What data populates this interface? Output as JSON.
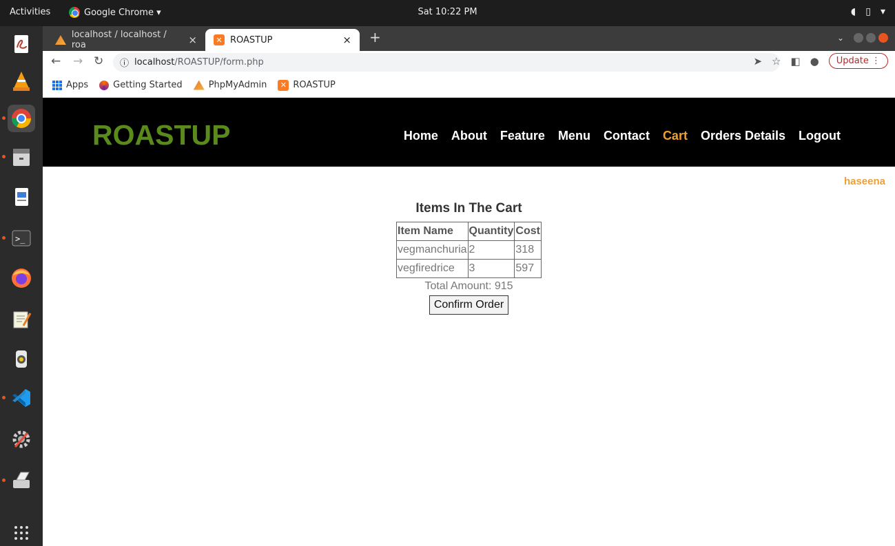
{
  "topbar": {
    "activities": "Activities",
    "app_name": "Google Chrome ▾",
    "clock": "Sat 10:22 PM"
  },
  "browser": {
    "tabs": [
      {
        "title": "localhost / localhost / roa",
        "active": false
      },
      {
        "title": "ROASTUP",
        "active": true
      }
    ],
    "url_host": "localhost",
    "url_path": "/ROASTUP/form.php",
    "update_label": "Update",
    "bookmarks": [
      "Apps",
      "Getting Started",
      "PhpMyAdmin",
      "ROASTUP"
    ]
  },
  "site": {
    "logo": "ROASTUP",
    "nav": [
      "Home",
      "About",
      "Feature",
      "Menu",
      "Contact",
      "Cart",
      "Orders Details",
      "Logout"
    ],
    "active_nav": "Cart",
    "username": "haseena"
  },
  "cart": {
    "heading": "Items In The Cart",
    "columns": [
      "Item Name",
      "Quantity",
      "Cost"
    ],
    "rows": [
      [
        "vegmanchuria",
        "2",
        "318"
      ],
      [
        "vegfiredrice",
        "3",
        "597"
      ]
    ],
    "total": "Total Amount: 915",
    "confirm_label": "Confirm Order"
  },
  "colors": {
    "logo": "#5a8a1c",
    "accent": "#f0a030",
    "header_bg": "#000000"
  }
}
